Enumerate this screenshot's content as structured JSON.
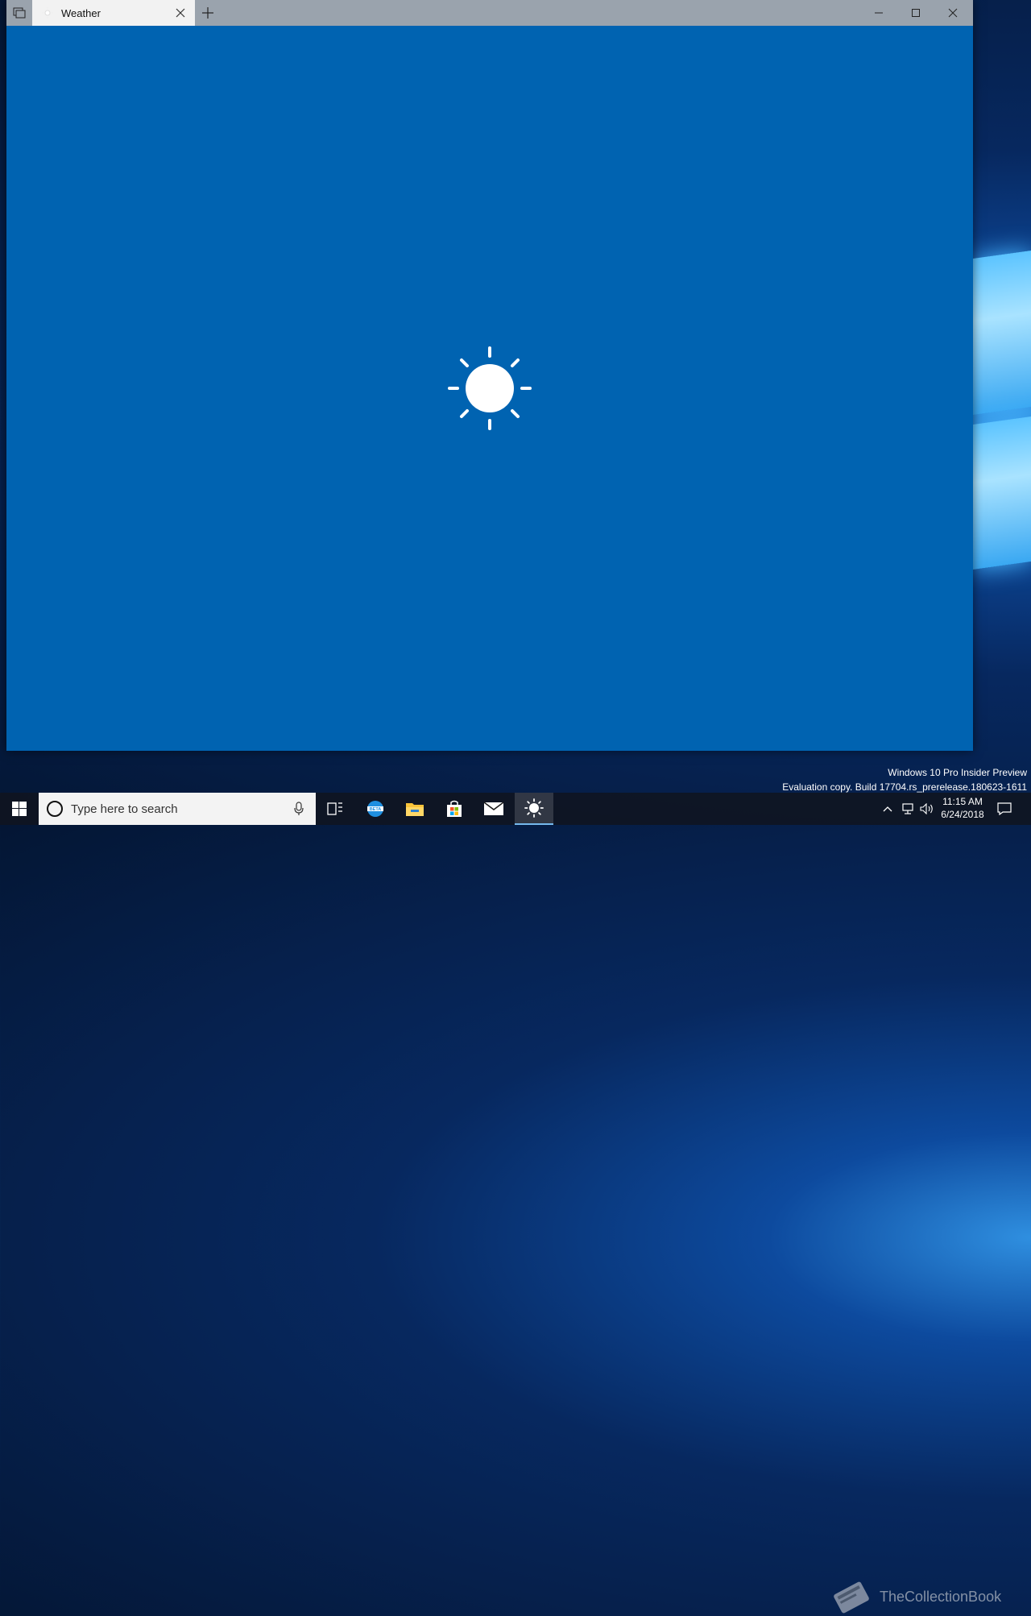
{
  "window": {
    "tab_title": "Weather",
    "app_bg": "#0063b1",
    "titlebar_bg": "#9aa3ad"
  },
  "watermark": {
    "line1": "Windows 10 Pro Insider Preview",
    "line2": "Evaluation copy. Build 17704.rs_prerelease.180623-1611",
    "logo_text": "TheCollectionBook"
  },
  "taskbar": {
    "search_placeholder": "Type here to search",
    "apps": [
      {
        "name": "task-view-icon"
      },
      {
        "name": "edge-beta-icon"
      },
      {
        "name": "file-explorer-icon"
      },
      {
        "name": "store-icon"
      },
      {
        "name": "mail-icon"
      },
      {
        "name": "weather-sun-icon",
        "active": true
      }
    ],
    "clock": {
      "time": "11:15 AM",
      "date": "6/24/2018"
    }
  }
}
